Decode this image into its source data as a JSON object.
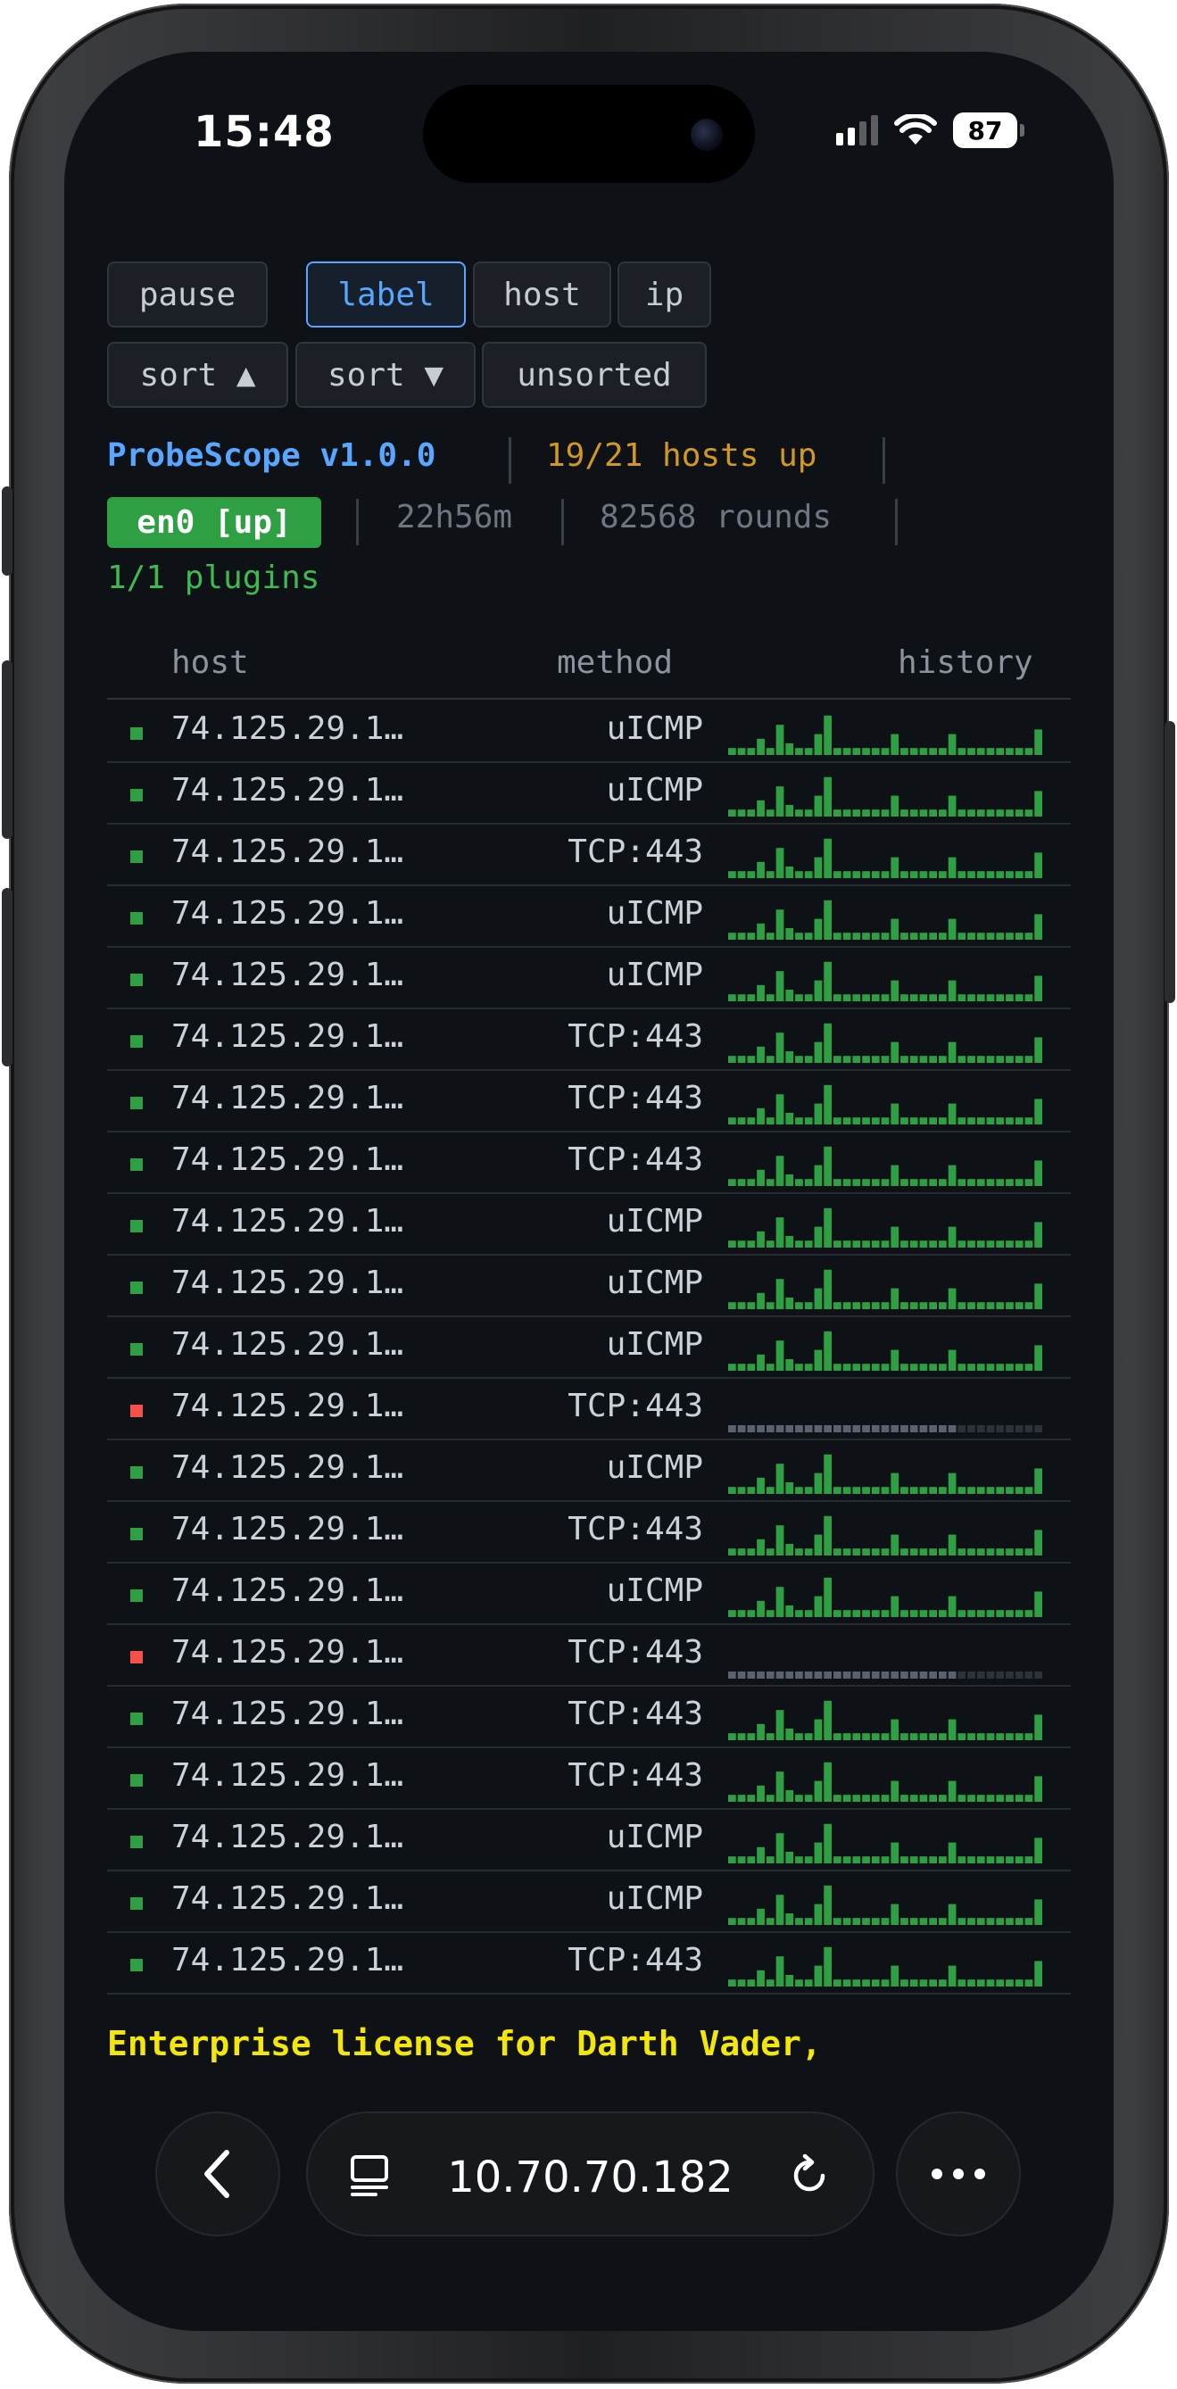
{
  "status_bar": {
    "time": "15:48",
    "battery": "87"
  },
  "toolbar": {
    "row1": [
      "pause",
      "label",
      "host",
      "ip"
    ],
    "row2": [
      "sort ▲",
      "sort ▼",
      "unsorted"
    ],
    "active": "label"
  },
  "info": {
    "app_name": "ProbeScope v1.0.0",
    "hosts_up": "19/21 hosts up",
    "interface": "en0 [up]",
    "uptime": "22h56m",
    "rounds": "82568 rounds",
    "plugins": "1/1 plugins"
  },
  "table": {
    "headers": {
      "host": "host",
      "method": "method",
      "history": "history"
    },
    "rows": [
      {
        "host": "74.125.29.1…",
        "method": "uICMP",
        "status": "up"
      },
      {
        "host": "74.125.29.1…",
        "method": "uICMP",
        "status": "up"
      },
      {
        "host": "74.125.29.1…",
        "method": "TCP:443",
        "status": "up"
      },
      {
        "host": "74.125.29.1…",
        "method": "uICMP",
        "status": "up"
      },
      {
        "host": "74.125.29.1…",
        "method": "uICMP",
        "status": "up"
      },
      {
        "host": "74.125.29.1…",
        "method": "TCP:443",
        "status": "up"
      },
      {
        "host": "74.125.29.1…",
        "method": "TCP:443",
        "status": "up"
      },
      {
        "host": "74.125.29.1…",
        "method": "TCP:443",
        "status": "up"
      },
      {
        "host": "74.125.29.1…",
        "method": "uICMP",
        "status": "up"
      },
      {
        "host": "74.125.29.1…",
        "method": "uICMP",
        "status": "up"
      },
      {
        "host": "74.125.29.1…",
        "method": "uICMP",
        "status": "up"
      },
      {
        "host": "74.125.29.1…",
        "method": "TCP:443",
        "status": "down"
      },
      {
        "host": "74.125.29.1…",
        "method": "uICMP",
        "status": "up"
      },
      {
        "host": "74.125.29.1…",
        "method": "TCP:443",
        "status": "up"
      },
      {
        "host": "74.125.29.1…",
        "method": "uICMP",
        "status": "up"
      },
      {
        "host": "74.125.29.1…",
        "method": "TCP:443",
        "status": "down"
      },
      {
        "host": "74.125.29.1…",
        "method": "TCP:443",
        "status": "up"
      },
      {
        "host": "74.125.29.1…",
        "method": "TCP:443",
        "status": "up"
      },
      {
        "host": "74.125.29.1…",
        "method": "uICMP",
        "status": "up"
      },
      {
        "host": "74.125.29.1…",
        "method": "uICMP",
        "status": "up"
      },
      {
        "host": "74.125.29.1…",
        "method": "TCP:443",
        "status": "up"
      }
    ],
    "history_levels": [
      0.15,
      0.15,
      0.15,
      0.35,
      0.15,
      0.65,
      0.25,
      0.15,
      0.15,
      0.45,
      0.85,
      0.15,
      0.15,
      0.15,
      0.15,
      0.15,
      0.15,
      0.45,
      0.15,
      0.15,
      0.15,
      0.15,
      0.15,
      0.45,
      0.15,
      0.15,
      0.15,
      0.15,
      0.15,
      0.15,
      0.15,
      0.15,
      0.55
    ]
  },
  "footer": {
    "license": "Enterprise license for Darth Vader,"
  },
  "browser": {
    "url": "10.70.70.182"
  },
  "colors": {
    "up": "#2ea043",
    "down": "#f85149",
    "accent": "#58a6ff",
    "warning": "#d29922",
    "license": "#f2e60a"
  }
}
